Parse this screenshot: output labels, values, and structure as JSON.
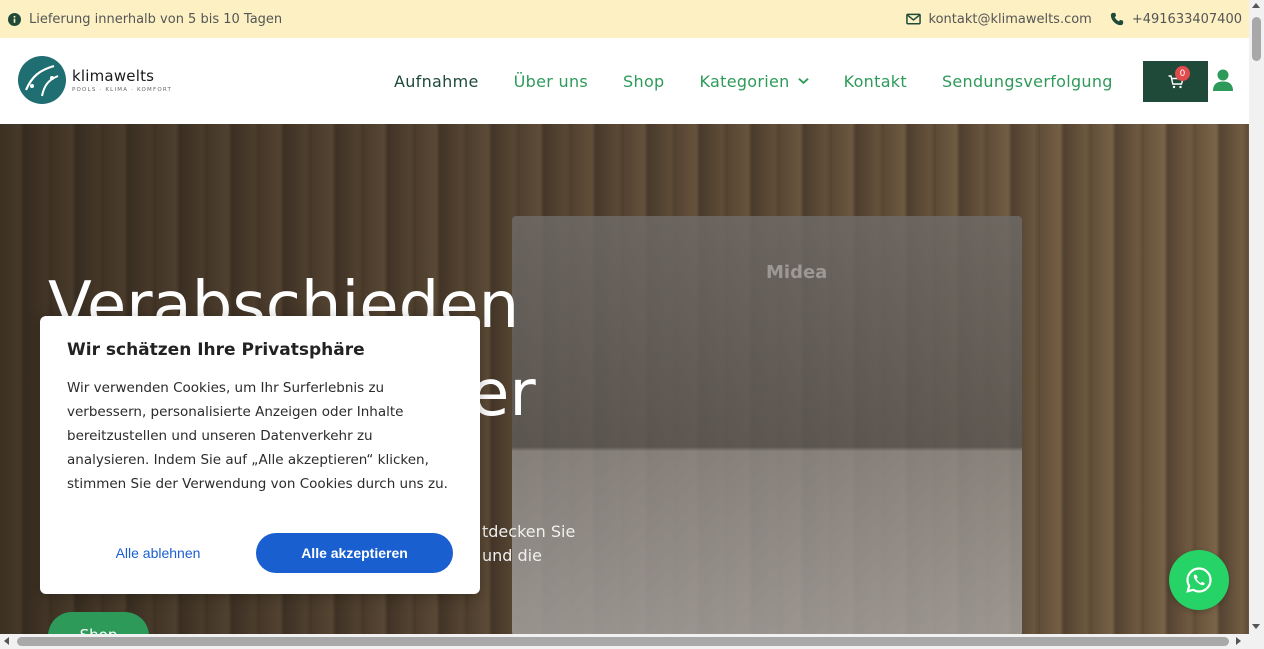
{
  "topbar": {
    "delivery": "Lieferung innerhalb von 5 bis 10 Tagen",
    "email": "kontakt@klimawelts.com",
    "phone": "+491633407400"
  },
  "logo": {
    "name": "klimawelts",
    "tagline": "POOLS · KLIMA · KOMFORT"
  },
  "nav": {
    "items": [
      {
        "label": "Aufnahme"
      },
      {
        "label": "Über uns"
      },
      {
        "label": "Shop"
      },
      {
        "label": "Kategorien"
      },
      {
        "label": "Kontakt"
      },
      {
        "label": "Sendungsverfolgung"
      }
    ]
  },
  "cart": {
    "count": "0"
  },
  "hero": {
    "heading_line1": "Verabschieden",
    "heading_line2": "er",
    "subtext_line1": "tdecken Sie",
    "subtext_line2": "und die",
    "shop_button": "Shop",
    "unit_brand": "Midea"
  },
  "cookie": {
    "title": "Wir schätzen Ihre Privatsphäre",
    "text": "Wir verwenden Cookies, um Ihr Surferlebnis zu verbessern, personalisierte Anzeigen oder Inhalte bereitzustellen und unseren Datenverkehr zu analysieren. Indem Sie auf „Alle akzeptieren“ klicken, stimmen Sie der Verwendung von Cookies durch uns zu.",
    "decline": "Alle ablehnen",
    "accept": "Alle akzeptieren"
  },
  "colors": {
    "topbar_bg": "#fdf1c4",
    "nav_green": "#2e9a5a",
    "dark_green": "#1f4a3a",
    "accept_blue": "#1a5fd0",
    "whatsapp": "#25d366"
  }
}
